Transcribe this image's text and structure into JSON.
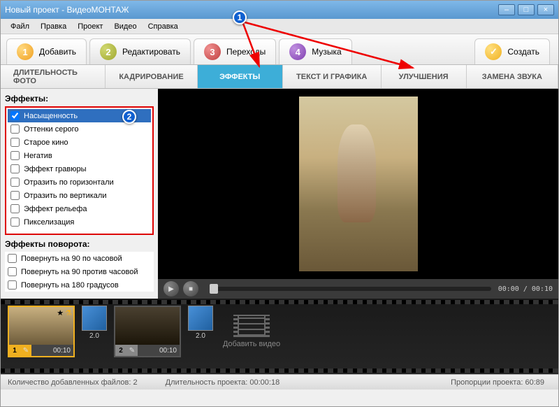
{
  "window": {
    "title": "Новый проект - ВидеоМОНТАЖ"
  },
  "menu": [
    "Файл",
    "Правка",
    "Проект",
    "Видео",
    "Справка"
  ],
  "steps": [
    {
      "num": "1",
      "label": "Добавить",
      "cls": "orange"
    },
    {
      "num": "2",
      "label": "Редактировать",
      "cls": "olive"
    },
    {
      "num": "3",
      "label": "Переходы",
      "cls": "ruby"
    },
    {
      "num": "4",
      "label": "Музыка",
      "cls": "purple"
    },
    {
      "num": "✓",
      "label": "Создать",
      "cls": "check"
    }
  ],
  "subtabs": [
    "ДЛИТЕЛЬНОСТЬ ФОТО",
    "КАДРИРОВАНИЕ",
    "ЭФФЕКТЫ",
    "ТЕКСТ И ГРАФИКА",
    "УЛУЧШЕНИЯ",
    "ЗАМЕНА ЗВУКА"
  ],
  "subtab_active": 2,
  "effects_title": "Эффекты:",
  "effects": [
    {
      "label": "Насыщенность",
      "checked": true,
      "selected": true
    },
    {
      "label": "Оттенки серого",
      "checked": false
    },
    {
      "label": "Старое кино",
      "checked": false
    },
    {
      "label": "Негатив",
      "checked": false
    },
    {
      "label": "Эффект гравюры",
      "checked": false
    },
    {
      "label": "Отразить по горизонтали",
      "checked": false
    },
    {
      "label": "Отразить по вертикали",
      "checked": false
    },
    {
      "label": "Эффект рельефа",
      "checked": false
    },
    {
      "label": "Пикселизация",
      "checked": false
    }
  ],
  "rotation_title": "Эффекты поворота:",
  "rotations": [
    {
      "label": "Повернуть на 90 по часовой"
    },
    {
      "label": "Повернуть на 90 против часовой"
    },
    {
      "label": "Повернуть на 180 градусов"
    }
  ],
  "player": {
    "time": "00:00 / 00:10"
  },
  "timeline": {
    "clips": [
      {
        "num": "1",
        "time": "00:10",
        "active": true,
        "star": true,
        "flask": true
      },
      {
        "num": "2",
        "time": "00:10",
        "active": false,
        "star": false,
        "flask": false
      }
    ],
    "transitions": [
      {
        "label": "2.0"
      },
      {
        "label": "2.0"
      }
    ],
    "add_label": "Добавить видео"
  },
  "status": {
    "files_label": "Количество добавленных файлов:",
    "files_value": "2",
    "duration_label": "Длительность проекта:",
    "duration_value": "00:00:18",
    "ratio_label": "Пропорции проекта:",
    "ratio_value": "60:89"
  },
  "callouts": {
    "c1": "1",
    "c2": "2"
  }
}
